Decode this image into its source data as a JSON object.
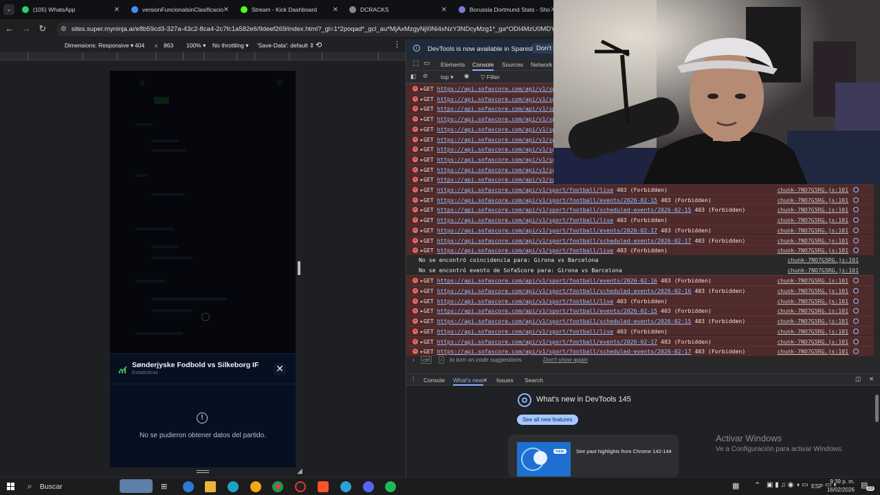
{
  "browser": {
    "tabs": [
      {
        "title": "(105) WhatsApp",
        "icon": "whatsapp-icon",
        "color": "#25d366"
      },
      {
        "title": "versionFuncionalsinClasificacio",
        "icon": "link-icon",
        "color": "#4c8bf5"
      },
      {
        "title": "Stream - Kick Dashboard",
        "icon": "kick-icon",
        "color": "#53fc18"
      },
      {
        "title": "DCRACKS",
        "icon": "dcracks-icon",
        "color": "#888888"
      },
      {
        "title": "Borussia Dortmund Stats - Sho",
        "icon": "shield-icon",
        "color": "#7b7bd6"
      }
    ],
    "url": "sites.super.myninja.ai/e8b59cd3-327a-43c2-8ca4-2c7fc1a582e6/9deef269/index.html?_gl=1*2poqad*_gcl_au*MjAxMzgyNjI0Ni4xNzY3NDcyMzg1*_ga*ODI4MzU0MDYzLjE"
  },
  "device_toolbar": {
    "dimensions": "Dimensions: Responsive",
    "width": "404",
    "x": "x",
    "height": "863",
    "zoom": "100%",
    "throttling": "No throttling",
    "save_data": "'Save-Data': default"
  },
  "page": {
    "sheet_title": "Sønderjyske Fodbold vs Silkeborg IF",
    "sheet_subtitle": "Estadísticas",
    "error_message": "No se pudieron obtener datos del partido."
  },
  "devtools": {
    "infobar_text": "DevTools is now available in Spanish",
    "infobar_button": "Don't s",
    "tabs": [
      "Elements",
      "Console",
      "Sources",
      "Network"
    ],
    "active_tab": "Console",
    "context": "top",
    "filter_placeholder": "Filter",
    "console_rows": [
      {
        "type": "error",
        "method": "GET",
        "url": "https://api.sofascore.com/api/v1/spo",
        "status": "",
        "source": ""
      },
      {
        "type": "error",
        "method": "GET",
        "url": "https://api.sofascore.com/api/v1/spo",
        "status": "",
        "source": ""
      },
      {
        "type": "error",
        "method": "GET",
        "url": "https://api.sofascore.com/api/v1/spo",
        "status": "",
        "source": ""
      },
      {
        "type": "error",
        "method": "GET",
        "url": "https://api.sofascore.com/api/v1/spo",
        "status": "",
        "source": ""
      },
      {
        "type": "error",
        "method": "GET",
        "url": "https://api.sofascore.com/api/v1/spo",
        "status": "",
        "source": ""
      },
      {
        "type": "error",
        "method": "GET",
        "url": "https://api.sofascore.com/api/v1/spo",
        "status": "",
        "source": ""
      },
      {
        "type": "error",
        "method": "GET",
        "url": "https://api.sofascore.com/api/v1/spo",
        "status": "",
        "source": ""
      },
      {
        "type": "error",
        "method": "GET",
        "url": "https://api.sofascore.com/api/v1/spo",
        "status": "",
        "source": ""
      },
      {
        "type": "error",
        "method": "GET",
        "url": "https://api.sofascore.com/api/v1/spo",
        "status": "",
        "source": ""
      },
      {
        "type": "error",
        "method": "GET",
        "url": "https://api.sofascore.com/api/v1/spo",
        "status": "",
        "source": ""
      },
      {
        "type": "error",
        "method": "GET",
        "url": "https://api.sofascore.com/api/v1/sport/football/live",
        "status": "403 (Forbidden)",
        "source": "chunk-7NO7G5RG.js:101"
      },
      {
        "type": "error",
        "method": "GET",
        "url": "https://api.sofascore.com/api/v1/sport/football/events/2026-02-15",
        "status": "403 (Forbidden)",
        "source": "chunk-7NO7G5RG.js:101"
      },
      {
        "type": "error",
        "method": "GET",
        "url": "https://api.sofascore.com/api/v1/sport/football/scheduled-events/2026-02-15",
        "status": "403 (Forbidden)",
        "source": "chunk-7NO7G5RG.js:101"
      },
      {
        "type": "error",
        "method": "GET",
        "url": "https://api.sofascore.com/api/v1/sport/football/live",
        "status": "403 (Forbidden)",
        "source": "chunk-7NO7G5RG.js:101"
      },
      {
        "type": "error",
        "method": "GET",
        "url": "https://api.sofascore.com/api/v1/sport/football/events/2026-02-17",
        "status": "403 (Forbidden)",
        "source": "chunk-7NO7G5RG.js:101"
      },
      {
        "type": "error",
        "method": "GET",
        "url": "https://api.sofascore.com/api/v1/sport/football/scheduled-events/2026-02-17",
        "status": "403 (Forbidden)",
        "source": "chunk-7NO7G5RG.js:101"
      },
      {
        "type": "error",
        "method": "GET",
        "url": "https://api.sofascore.com/api/v1/sport/football/live",
        "status": "403 (Forbidden)",
        "source": "chunk-7NO7G5RG.js:101"
      },
      {
        "type": "log",
        "method": "",
        "url": "",
        "status": "No se encontró coincidencia para: Girona vs Barcelona",
        "source": "chunk-7NO7G5RG.js:101"
      },
      {
        "type": "log",
        "method": "",
        "url": "",
        "status": "No se encontró evento de SofaScore para: Girona vs Barcelona",
        "source": "chunk-7NO7G5RG.js:101"
      },
      {
        "type": "error",
        "method": "GET",
        "url": "https://api.sofascore.com/api/v1/sport/football/events/2026-02-16",
        "status": "403 (Forbidden)",
        "source": "chunk-7NO7G5RG.js:101"
      },
      {
        "type": "error",
        "method": "GET",
        "url": "https://api.sofascore.com/api/v1/sport/football/scheduled-events/2026-02-16",
        "status": "403 (Forbidden)",
        "source": "chunk-7NO7G5RG.js:101"
      },
      {
        "type": "error",
        "method": "GET",
        "url": "https://api.sofascore.com/api/v1/sport/football/live",
        "status": "403 (Forbidden)",
        "source": "chunk-7NO7G5RG.js:101"
      },
      {
        "type": "error",
        "method": "GET",
        "url": "https://api.sofascore.com/api/v1/sport/football/events/2026-02-15",
        "status": "403 (Forbidden)",
        "source": "chunk-7NO7G5RG.js:101"
      },
      {
        "type": "error",
        "method": "GET",
        "url": "https://api.sofascore.com/api/v1/sport/football/scheduled-events/2026-02-15",
        "status": "403 (Forbidden)",
        "source": "chunk-7NO7G5RG.js:101"
      },
      {
        "type": "error",
        "method": "GET",
        "url": "https://api.sofascore.com/api/v1/sport/football/live",
        "status": "403 (Forbidden)",
        "source": "chunk-7NO7G5RG.js:101"
      },
      {
        "type": "error",
        "method": "GET",
        "url": "https://api.sofascore.com/api/v1/sport/football/events/2026-02-17",
        "status": "403 (Forbidden)",
        "source": "chunk-7NO7G5RG.js:101"
      },
      {
        "type": "error",
        "method": "GET",
        "url": "https://api.sofascore.com/api/v1/sport/football/scheduled-events/2026-02-17",
        "status": "403 (Forbidden)",
        "source": "chunk-7NO7G5RG.js:101"
      }
    ],
    "prompt_hint_keys": "ctrl",
    "prompt_hint_key2": "i",
    "prompt_hint": "to turn on code suggestions.",
    "prompt_dismiss": "Don't show again",
    "drawer_tabs": [
      "Console",
      "What's new",
      "Issues",
      "Search"
    ],
    "drawer_active": "What's new",
    "whats_new_title": "What's new in DevTools 145",
    "whats_new_button": "See all new features",
    "whats_new_badge": "new",
    "whats_new_highlight": "See past highlights from Chrome 142-144"
  },
  "windows": {
    "activate_title": "Activar Windows",
    "activate_sub": "Ve a Configuración para activar Windows."
  },
  "taskbar": {
    "search": "Buscar",
    "lang": "ESP",
    "time": "9:39 p. m.",
    "date": "16/02/2026",
    "notifications": "23"
  },
  "colors": {
    "error_row": "#4e2a2a",
    "link": "#9ac1ff",
    "accent": "#8ab4f8"
  }
}
